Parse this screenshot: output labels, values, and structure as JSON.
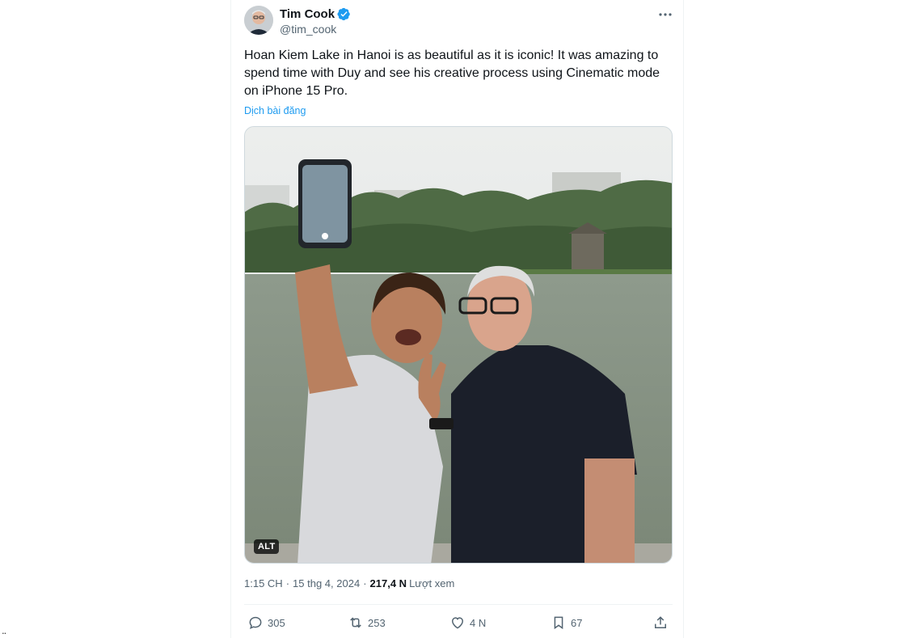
{
  "tweet": {
    "author": {
      "display_name": "Tim Cook",
      "handle": "@tim_cook",
      "verified": true
    },
    "text": "Hoan Kiem Lake in Hanoi is as beautiful as it is iconic! It was amazing to spend time with Duy and see his creative process using Cinematic mode on iPhone 15 Pro.",
    "translate_label": "Dịch bài đăng",
    "media": {
      "alt_badge": "ALT"
    },
    "meta": {
      "time": "1:15 CH",
      "date": "15 thg 4, 2024",
      "views_count": "217,4 N",
      "views_label": "Lượt xem"
    },
    "actions": {
      "replies": "305",
      "reposts": "253",
      "likes": "4 N",
      "bookmarks": "67"
    }
  },
  "corner_text": "..",
  "colors": {
    "accent": "#1d9bf0",
    "secondary_text": "#536471",
    "border": "#cfd9de"
  }
}
